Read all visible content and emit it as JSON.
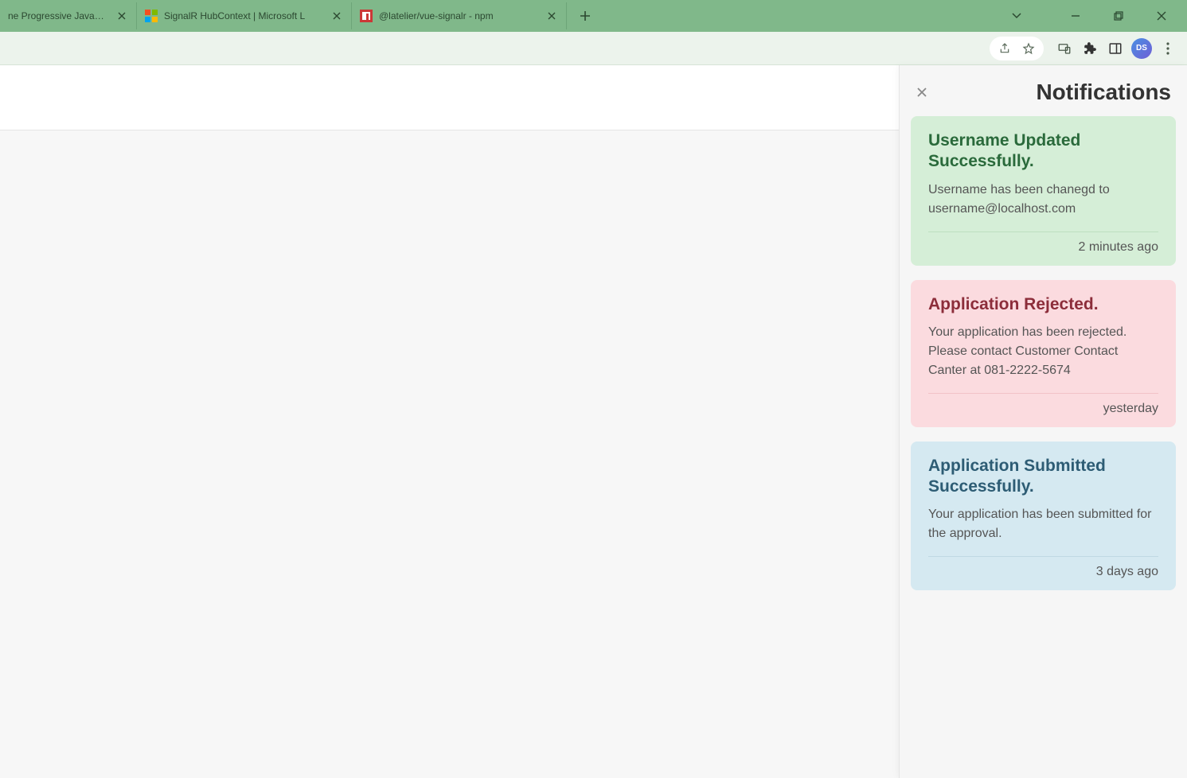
{
  "tabs": [
    {
      "title": "ne Progressive JavaScrip",
      "favicon": "vue"
    },
    {
      "title": "SignalR HubContext | Microsoft L",
      "favicon": "ms"
    },
    {
      "title": "@latelier/vue-signalr - npm",
      "favicon": "npm"
    }
  ],
  "panel": {
    "title": "Notifications"
  },
  "notifications": [
    {
      "type": "success",
      "title": "Username Updated Successfully.",
      "body": "Username has been chanegd to username@localhost.com",
      "time": "2 minutes ago"
    },
    {
      "type": "error",
      "title": "Application Rejected.",
      "body": "Your application has been rejected. Please contact Customer Contact Canter at 081-2222-5674",
      "time": "yesterday"
    },
    {
      "type": "info",
      "title": "Application Submitted Successfully.",
      "body": "Your application has been submitted for the approval.",
      "time": "3 days ago"
    }
  ]
}
